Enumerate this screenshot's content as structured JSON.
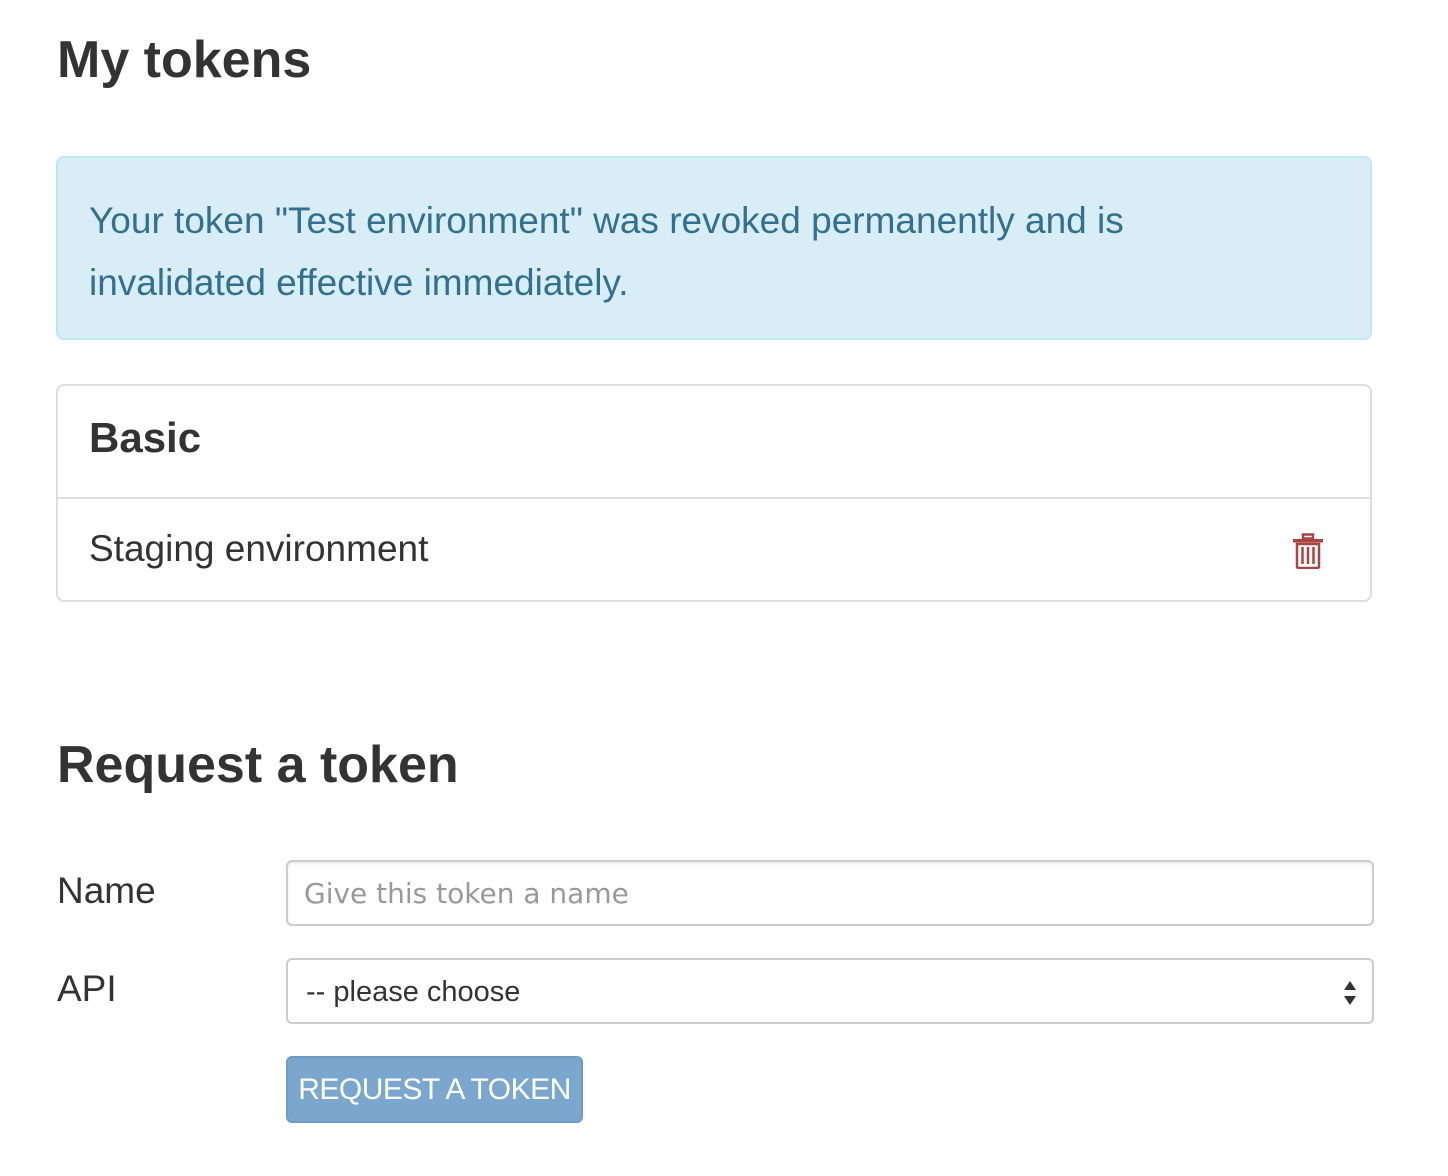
{
  "page": {
    "title": "My tokens"
  },
  "alert": {
    "message": "Your token \"Test environment\" was revoked permanently and is invalidated effective immediately."
  },
  "token_group": {
    "heading": "Basic",
    "tokens": [
      {
        "name": "Staging environment",
        "action_icon": "trash-icon"
      }
    ]
  },
  "request_form": {
    "title": "Request a token",
    "name_label": "Name",
    "name_placeholder": "Give this token a name",
    "name_value": "",
    "api_label": "API",
    "api_selected": "-- please choose",
    "submit_label": "REQUEST A TOKEN"
  },
  "colors": {
    "alert_bg": "#d9edf7",
    "alert_text": "#31708f",
    "danger": "#a94442",
    "button_bg": "#7ba7cf"
  }
}
